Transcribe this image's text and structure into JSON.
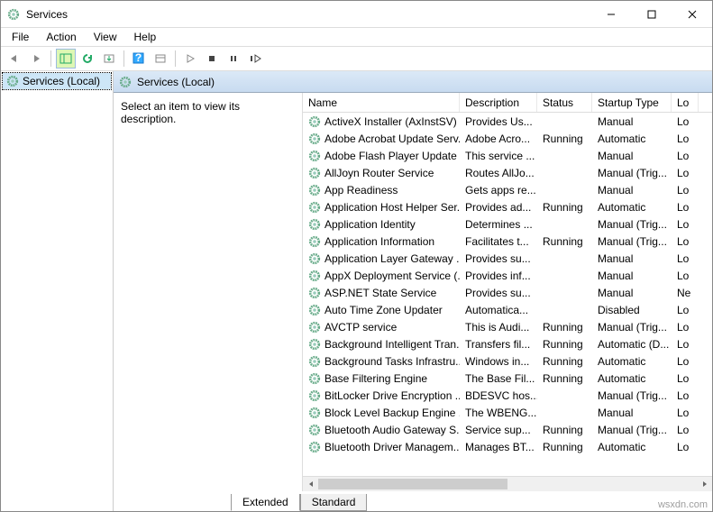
{
  "window": {
    "title": "Services"
  },
  "menu": {
    "file": "File",
    "action": "Action",
    "view": "View",
    "help": "Help"
  },
  "tree": {
    "root": "Services (Local)"
  },
  "pane": {
    "header": "Services (Local)",
    "desc_prompt": "Select an item to view its description."
  },
  "columns": {
    "name": "Name",
    "description": "Description",
    "status": "Status",
    "startup": "Startup Type",
    "logon": "Lo"
  },
  "tabs": {
    "extended": "Extended",
    "standard": "Standard"
  },
  "watermark": "wsxdn.com",
  "services": [
    {
      "name": "ActiveX Installer (AxInstSV)",
      "desc": "Provides Us...",
      "status": "",
      "startup": "Manual",
      "logon": "Lo"
    },
    {
      "name": "Adobe Acrobat Update Serv...",
      "desc": "Adobe Acro...",
      "status": "Running",
      "startup": "Automatic",
      "logon": "Lo"
    },
    {
      "name": "Adobe Flash Player Update ...",
      "desc": "This service ...",
      "status": "",
      "startup": "Manual",
      "logon": "Lo"
    },
    {
      "name": "AllJoyn Router Service",
      "desc": "Routes AllJo...",
      "status": "",
      "startup": "Manual (Trig...",
      "logon": "Lo"
    },
    {
      "name": "App Readiness",
      "desc": "Gets apps re...",
      "status": "",
      "startup": "Manual",
      "logon": "Lo"
    },
    {
      "name": "Application Host Helper Ser...",
      "desc": "Provides ad...",
      "status": "Running",
      "startup": "Automatic",
      "logon": "Lo"
    },
    {
      "name": "Application Identity",
      "desc": "Determines ...",
      "status": "",
      "startup": "Manual (Trig...",
      "logon": "Lo"
    },
    {
      "name": "Application Information",
      "desc": "Facilitates t...",
      "status": "Running",
      "startup": "Manual (Trig...",
      "logon": "Lo"
    },
    {
      "name": "Application Layer Gateway ...",
      "desc": "Provides su...",
      "status": "",
      "startup": "Manual",
      "logon": "Lo"
    },
    {
      "name": "AppX Deployment Service (...",
      "desc": "Provides inf...",
      "status": "",
      "startup": "Manual",
      "logon": "Lo"
    },
    {
      "name": "ASP.NET State Service",
      "desc": "Provides su...",
      "status": "",
      "startup": "Manual",
      "logon": "Ne"
    },
    {
      "name": "Auto Time Zone Updater",
      "desc": "Automatica...",
      "status": "",
      "startup": "Disabled",
      "logon": "Lo"
    },
    {
      "name": "AVCTP service",
      "desc": "This is Audi...",
      "status": "Running",
      "startup": "Manual (Trig...",
      "logon": "Lo"
    },
    {
      "name": "Background Intelligent Tran...",
      "desc": "Transfers fil...",
      "status": "Running",
      "startup": "Automatic (D...",
      "logon": "Lo"
    },
    {
      "name": "Background Tasks Infrastru...",
      "desc": "Windows in...",
      "status": "Running",
      "startup": "Automatic",
      "logon": "Lo"
    },
    {
      "name": "Base Filtering Engine",
      "desc": "The Base Fil...",
      "status": "Running",
      "startup": "Automatic",
      "logon": "Lo"
    },
    {
      "name": "BitLocker Drive Encryption ...",
      "desc": "BDESVC hos...",
      "status": "",
      "startup": "Manual (Trig...",
      "logon": "Lo"
    },
    {
      "name": "Block Level Backup Engine ...",
      "desc": "The WBENG...",
      "status": "",
      "startup": "Manual",
      "logon": "Lo"
    },
    {
      "name": "Bluetooth Audio Gateway S...",
      "desc": "Service sup...",
      "status": "Running",
      "startup": "Manual (Trig...",
      "logon": "Lo"
    },
    {
      "name": "Bluetooth Driver Managem...",
      "desc": "Manages BT...",
      "status": "Running",
      "startup": "Automatic",
      "logon": "Lo"
    }
  ]
}
